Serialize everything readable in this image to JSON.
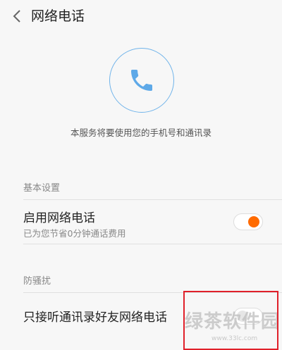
{
  "header": {
    "title": "网络电话",
    "back_icon": "chevron-left-icon"
  },
  "hero": {
    "icon": "phone-icon",
    "accent": "#5ea9e8",
    "description": "本服务将要使用您的手机号和通讯录"
  },
  "sections": [
    {
      "label": "基本设置",
      "items": [
        {
          "title": "启用网络电话",
          "subtitle": "已为您节省0分钟通话费用",
          "toggle_on": true
        }
      ]
    },
    {
      "label": "防骚扰",
      "items": [
        {
          "title": "只接听通讯录好友网络电话",
          "toggle_on": false
        }
      ]
    }
  ],
  "colors": {
    "toggle_on": "#ff6a00",
    "highlight": "#e0202a"
  },
  "watermark": {
    "text": "绿茶软件园",
    "sub": "www.33lc.com"
  }
}
